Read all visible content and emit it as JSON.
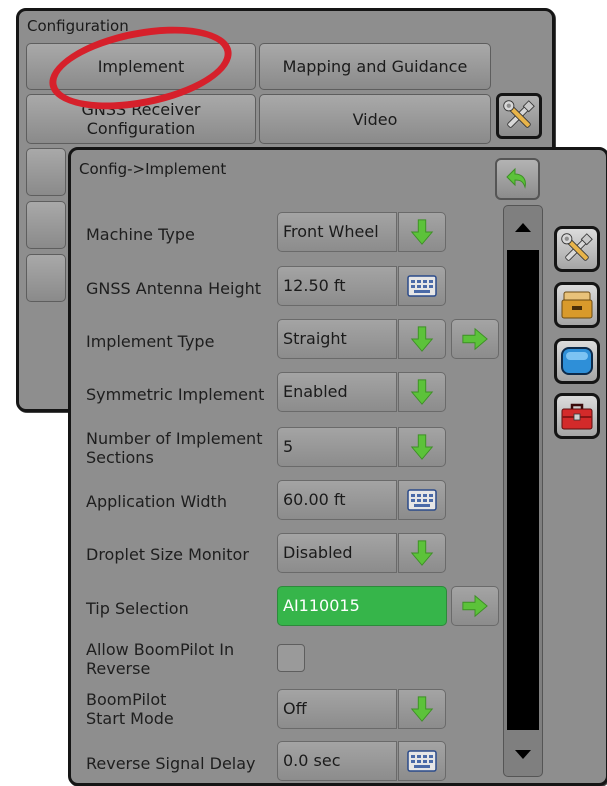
{
  "back_panel": {
    "title": "Configuration",
    "buttons": {
      "implement": "Implement",
      "mapping_guidance": "Mapping and Guidance",
      "gnss_receiver": "GNSS Receiver Configuration",
      "video": "Video"
    }
  },
  "front_panel": {
    "title": "Config->Implement",
    "rows": [
      {
        "label": "Machine Type",
        "value": "Front Wheel"
      },
      {
        "label": "GNSS Antenna Height",
        "value": "12.50 ft"
      },
      {
        "label": "Implement Type",
        "value": "Straight"
      },
      {
        "label": "Symmetric Implement",
        "value": "Enabled"
      },
      {
        "label": "Number of Implement Sections",
        "value": "5"
      },
      {
        "label": "Application Width",
        "value": "60.00 ft"
      },
      {
        "label": "Droplet Size Monitor",
        "value": "Disabled"
      },
      {
        "label": "Tip Selection",
        "value": "AI110015"
      },
      {
        "label": "Allow BoomPilot In Reverse",
        "value": ""
      },
      {
        "label": "BoomPilot Start Mode",
        "value": "Off"
      },
      {
        "label": "Reverse Signal Delay",
        "value": "0.0 sec"
      }
    ]
  },
  "colors": {
    "panel_bg": "#8e8e8e",
    "panel_border": "#151515",
    "highlight_ring": "#d6202b",
    "selected_value": "#36b54a",
    "arrow_green": "#5cc23a"
  },
  "icons": [
    "tools-icon",
    "back-arrow-icon",
    "down-arrow-icon",
    "right-arrow-icon",
    "keyboard-icon",
    "console-icon",
    "display-icon",
    "toolbox-icon",
    "scroll-up-icon",
    "scroll-down-icon"
  ]
}
